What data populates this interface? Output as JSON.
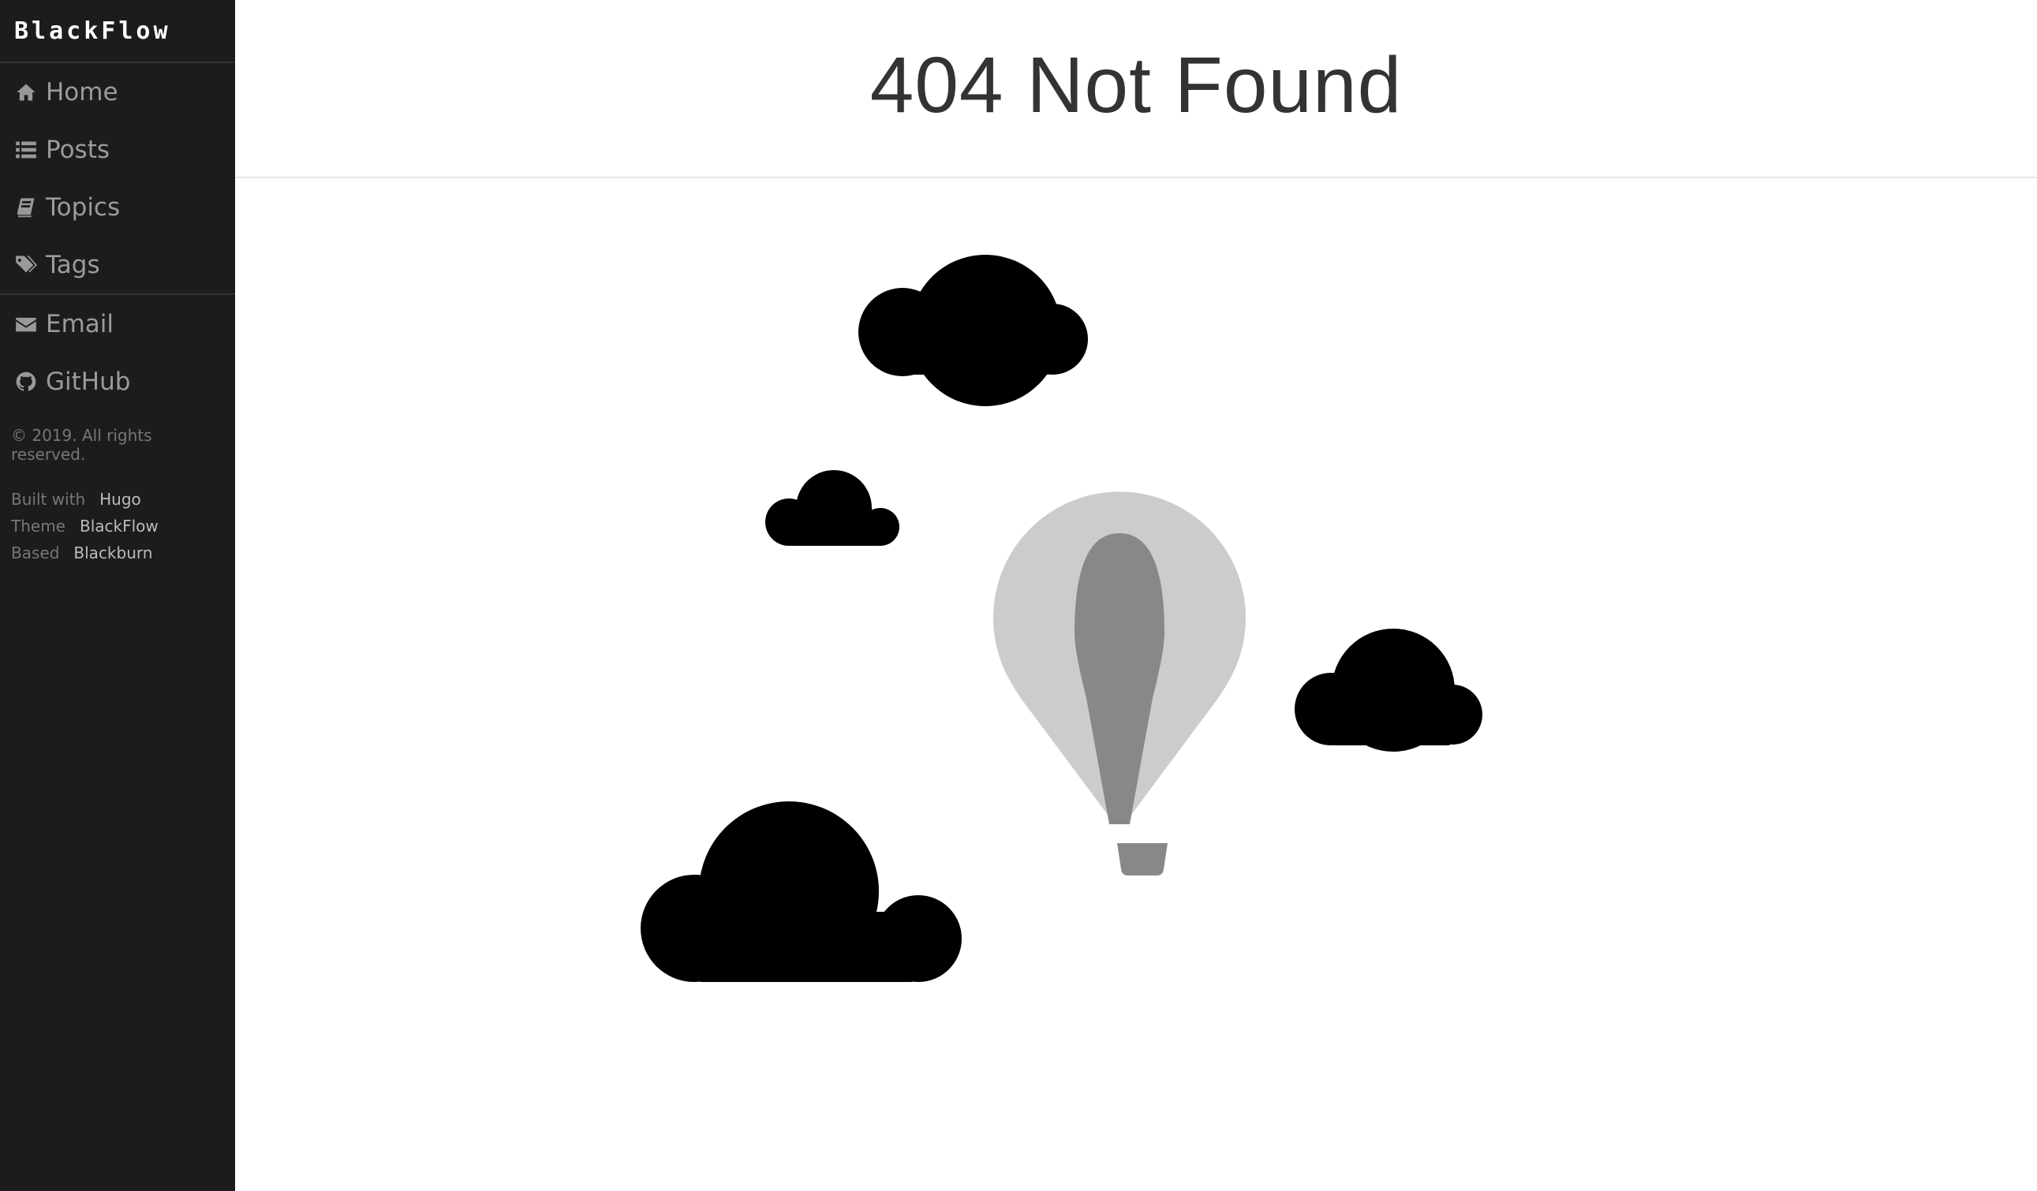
{
  "sidebar": {
    "brand": "BlackFlow",
    "nav": [
      {
        "label": "Home",
        "icon": "home-icon"
      },
      {
        "label": "Posts",
        "icon": "list-icon"
      },
      {
        "label": "Topics",
        "icon": "book-icon"
      },
      {
        "label": "Tags",
        "icon": "tags-icon"
      }
    ],
    "social": [
      {
        "label": "Email",
        "icon": "envelope-icon"
      },
      {
        "label": "GitHub",
        "icon": "github-icon"
      }
    ],
    "copyright": "© 2019. All rights reserved.",
    "credits": [
      {
        "key": "Built with",
        "value": "Hugo"
      },
      {
        "key": "Theme",
        "value": "BlackFlow"
      },
      {
        "key": "Based",
        "value": "Blackburn"
      }
    ]
  },
  "main": {
    "title": "404 Not Found",
    "illustration": {
      "clouds_color": "#000000",
      "balloon_envelope_color": "#cccccc",
      "balloon_stripe_color": "#888888",
      "basket_color": "#888888"
    }
  },
  "colors": {
    "sidebar_bg": "#1c1c1c",
    "title_color": "#333333"
  }
}
